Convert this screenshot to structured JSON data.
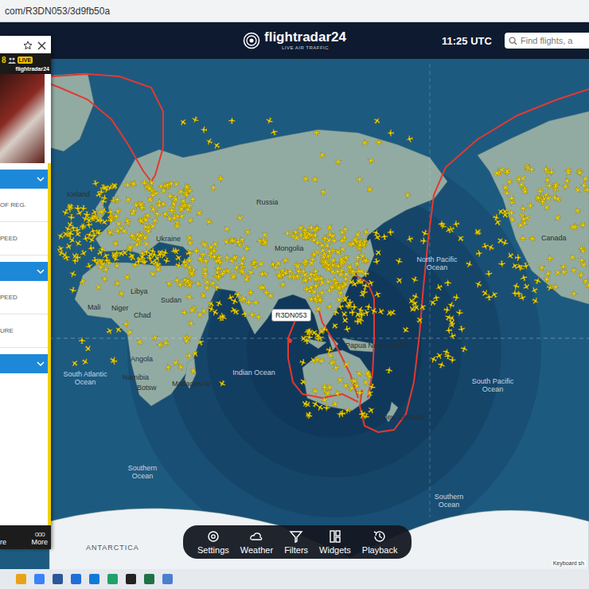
{
  "browser": {
    "url": "com/R3DN053/3d9fb50a"
  },
  "header": {
    "logo": "flightradar24",
    "tagline": "LIVE AIR TRAFFIC",
    "time": "11:25 UTC",
    "search": {
      "placeholder": "Find flights, a"
    }
  },
  "left_panel": {
    "logo": "flightradar24",
    "viewers": "8",
    "badge": "LIVE",
    "rows": [
      {
        "kind": "header"
      },
      {
        "kind": "text",
        "label": "OF REG."
      },
      {
        "kind": "text",
        "label": "PEED"
      },
      {
        "kind": "header"
      },
      {
        "kind": "text",
        "label": "PEED"
      },
      {
        "kind": "text",
        "label": "URE"
      },
      {
        "kind": "header"
      }
    ],
    "bottom_buttons": [
      {
        "icon": "",
        "label": "re"
      },
      {
        "icon": "ooo",
        "label": "More"
      }
    ]
  },
  "map": {
    "labels": [
      {
        "text": "Iceland",
        "kind": "country"
      },
      {
        "text": "Russia",
        "kind": "country"
      },
      {
        "text": "Ukraine",
        "kind": "country"
      },
      {
        "text": "Mongolia",
        "kind": "country"
      },
      {
        "text": "Libya",
        "kind": "country"
      },
      {
        "text": "Mali",
        "kind": "country"
      },
      {
        "text": "Niger",
        "kind": "country"
      },
      {
        "text": "Chad",
        "kind": "country"
      },
      {
        "text": "Sudan",
        "kind": "country"
      },
      {
        "text": "Angola",
        "kind": "country"
      },
      {
        "text": "Namibia",
        "kind": "country"
      },
      {
        "text": "Botsw",
        "kind": "country"
      },
      {
        "text": "Madagascar",
        "kind": "country"
      },
      {
        "text": "South Atlantic Ocean",
        "kind": "ocean"
      },
      {
        "text": "Indian Ocean",
        "kind": "ocean"
      },
      {
        "text": "Papua New Guinea",
        "kind": "country"
      },
      {
        "text": "New Zealand",
        "kind": "country"
      },
      {
        "text": "North Pacific Ocean",
        "kind": "ocean"
      },
      {
        "text": "South Pacific Ocean",
        "kind": "ocean"
      },
      {
        "text": "Southern Ocean",
        "kind": "ocean"
      },
      {
        "text": "Southern Ocean",
        "kind": "ocean"
      },
      {
        "text": "ANTARCTICA",
        "kind": "antarctic"
      },
      {
        "text": "Canada",
        "kind": "country"
      }
    ],
    "flight": {
      "callsign": "R3DN053"
    },
    "attribution": "Keyboard sh"
  },
  "toolbar": [
    {
      "label": "Settings"
    },
    {
      "label": "Weather"
    },
    {
      "label": "Filters"
    },
    {
      "label": "Widgets"
    },
    {
      "label": "Playback"
    }
  ]
}
